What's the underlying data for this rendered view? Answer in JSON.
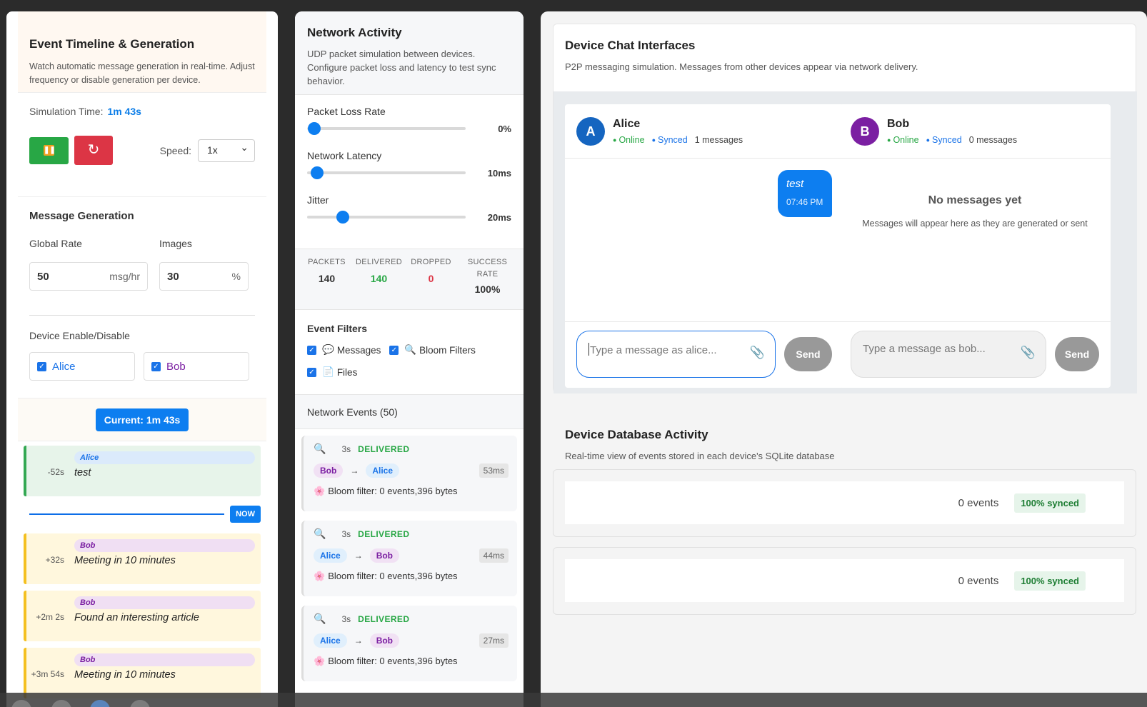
{
  "timeline": {
    "title": "Event Timeline & Generation",
    "desc": "Watch automatic message generation in real-time. Adjust frequency or disable generation per device.",
    "sim_label": "Simulation Time:",
    "sim_value": "1m 43s",
    "play_icon": "pause-icon",
    "reset_glyph": "↻",
    "speed_label": "Speed:",
    "speed_value": "1x",
    "gen_title": "Message Generation",
    "rate_label": "Global Rate",
    "rate_value": "50",
    "rate_unit": "msg/hr",
    "images_label": "Images",
    "images_value": "30",
    "images_unit": "%",
    "device_title": "Device Enable/Disable",
    "devices": [
      {
        "name": "Alice",
        "color": "#1a73e8",
        "checked": true
      },
      {
        "name": "Bob",
        "color": "#7b1fa2",
        "checked": true
      }
    ],
    "current_label": "Current: 1m 43s",
    "now_label": "NOW",
    "events": [
      {
        "time": "-52s",
        "device": "Alice",
        "text": "test"
      },
      {
        "time": "+32s",
        "device": "Bob",
        "text": "Meeting in 10 minutes"
      },
      {
        "time": "+2m 2s",
        "device": "Bob",
        "text": "Found an interesting article"
      },
      {
        "time": "+3m 54s",
        "device": "Bob",
        "text": "Meeting in 10 minutes"
      }
    ]
  },
  "network": {
    "title": "Network Activity",
    "desc": "UDP packet simulation between devices. Configure packet loss and latency to test sync behavior.",
    "sliders": [
      {
        "label": "Packet Loss Rate",
        "value": "0%",
        "level": 0.0
      },
      {
        "label": "Network Latency",
        "value": "10ms",
        "level": 0.02
      },
      {
        "label": "Jitter",
        "value": "20ms",
        "level": 0.18
      }
    ],
    "stats": [
      {
        "label": "PACKETS",
        "value": "140",
        "color": "#333333"
      },
      {
        "label": "DELIVERED",
        "value": "140",
        "color": "#28a745"
      },
      {
        "label": "DROPPED",
        "value": "0",
        "color": "#dc3545"
      },
      {
        "label": "SUCCESS RATE",
        "value": "100%",
        "color": "#333333"
      }
    ],
    "filters_title": "Event Filters",
    "filters": [
      {
        "icon": "💬",
        "label": "Messages"
      },
      {
        "icon": "🔍",
        "label": "Bloom Filters"
      },
      {
        "icon": "📄",
        "label": "Files"
      }
    ],
    "events_title": "Network Events (50)",
    "events": [
      {
        "icon": "🔍",
        "age": "3s",
        "status": "DELIVERED",
        "from": "Bob",
        "to": "Alice",
        "latency": "53ms",
        "detail": "Bloom filter: 0 events,396 bytes"
      },
      {
        "icon": "🔍",
        "age": "3s",
        "status": "DELIVERED",
        "from": "Alice",
        "to": "Bob",
        "latency": "44ms",
        "detail": "Bloom filter: 0 events,396 bytes"
      },
      {
        "icon": "🔍",
        "age": "3s",
        "status": "DELIVERED",
        "from": "Alice",
        "to": "Bob",
        "latency": "27ms",
        "detail": "Bloom filter: 0 events,396 bytes"
      }
    ],
    "detail_icon": "🌸",
    "arrow": "→"
  },
  "chat": {
    "title": "Device Chat Interfaces",
    "desc": "P2P messaging simulation. Messages from other devices appear via network delivery.",
    "online": "Online",
    "synced": "Synced",
    "send": "Send",
    "devices": [
      {
        "initial": "A",
        "name": "Alice",
        "count": "1 messages",
        "color": "#1565c0",
        "placeholder": "Type a message as alice...",
        "messages": [
          {
            "text": "test",
            "time": "07:46 PM"
          }
        ]
      },
      {
        "initial": "B",
        "name": "Bob",
        "count": "0 messages",
        "color": "#7b1fa2",
        "placeholder": "Type a message as bob...",
        "empty_title": "No messages yet",
        "empty_desc": "Messages will appear here as they are generated or sent"
      }
    ]
  },
  "database": {
    "title": "Device Database Activity",
    "desc": "Real-time view of events stored in each device's SQLite database",
    "rows": [
      {
        "events": "0 events",
        "sync": "100% synced"
      },
      {
        "events": "0 events",
        "sync": "100% synced"
      }
    ]
  }
}
